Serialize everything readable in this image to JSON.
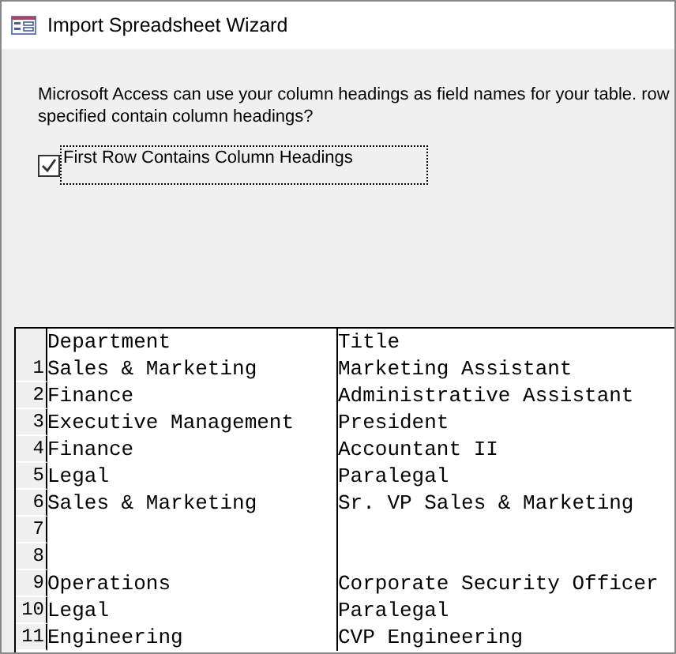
{
  "window": {
    "title": "Import Spreadsheet Wizard"
  },
  "instructions": "Microsoft Access can use your column headings as field names for your table. row specified contain column headings?",
  "checkbox": {
    "label": "First Row Contains Column Headings",
    "checked": true
  },
  "table": {
    "columns": [
      "Department",
      "Title"
    ],
    "rows": [
      {
        "number": "1",
        "cells": [
          "Sales & Marketing",
          "Marketing Assistant"
        ]
      },
      {
        "number": "2",
        "cells": [
          "Finance",
          "Administrative Assistant"
        ]
      },
      {
        "number": "3",
        "cells": [
          "Executive Management",
          "President"
        ]
      },
      {
        "number": "4",
        "cells": [
          "Finance",
          "Accountant II"
        ]
      },
      {
        "number": "5",
        "cells": [
          "Legal",
          "Paralegal"
        ]
      },
      {
        "number": "6",
        "cells": [
          "Sales & Marketing",
          "Sr. VP Sales & Marketing"
        ]
      },
      {
        "number": "7",
        "cells": []
      },
      {
        "number": "8",
        "cells": []
      },
      {
        "number": "9",
        "cells": [
          "Operations",
          "Corporate Security Officer"
        ]
      },
      {
        "number": "10",
        "cells": [
          "Legal",
          "Paralegal"
        ]
      },
      {
        "number": "11",
        "cells": [
          "Engineering",
          "CVP Engineering"
        ]
      }
    ]
  }
}
